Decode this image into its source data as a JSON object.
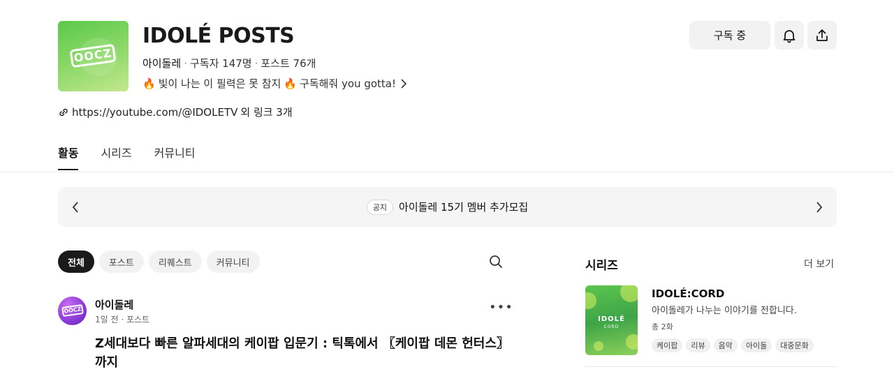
{
  "channel": {
    "logo_text": "OOCZ",
    "title": "IDOLÉ POSTS",
    "owner": "아이돌레",
    "subscribers": "구독자 147명",
    "posts": "포스트 76개",
    "description_part1": "빛이 나는 이 필력은 못 참지",
    "description_part2": "구독해줘 you gotta!",
    "link_text": "https://youtube.com/@IDOLETV",
    "link_extra": "외 링크 3개"
  },
  "actions": {
    "subscribe_label": "구독 중"
  },
  "tabs": [
    "활동",
    "시리즈",
    "커뮤니티"
  ],
  "notice": {
    "badge": "공지",
    "text": "아이돌레 15기 멤버 추가모집"
  },
  "filters": [
    "전체",
    "포스트",
    "리퀘스트",
    "커뮤니티"
  ],
  "post": {
    "avatar_text": "OOCZ",
    "author": "아이돌레",
    "meta": "1일 전 · 포스트",
    "title": "Z세대보다 빠른 알파세대의 케이팝 입문기 : 틱톡에서 〖케이팝 데몬 헌터스〗까지"
  },
  "series": {
    "heading": "시리즈",
    "more_label": "더 보기",
    "thumb_title": "IDOLÉ",
    "thumb_subtitle": "CORD",
    "name": "IDOLÉ:CORD",
    "description": "아이돌레가 나누는 이야기를 전합니다.",
    "count": "총 2화",
    "tags": [
      "케이팝",
      "리뷰",
      "음악",
      "아이돌",
      "대중문화"
    ]
  },
  "colors": {
    "brand_green": "#5bc94a",
    "avatar_purple": "#8a3ad6",
    "active_chip": "#1a1a1a"
  }
}
